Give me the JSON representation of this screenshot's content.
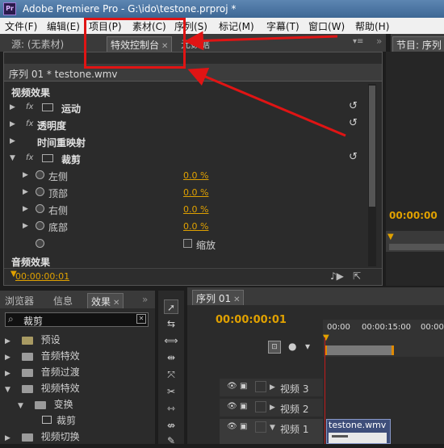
{
  "window": {
    "title": "Adobe Premiere Pro - G:\\ido\\testone.prproj *",
    "logo": "Pr"
  },
  "menu": [
    "文件(F)",
    "编辑(E)",
    "项目(P)",
    "素材(C)",
    "序列(S)",
    "标记(M)",
    "字幕(T)",
    "窗口(W)",
    "帮助(H)"
  ],
  "upper_left_tabs": {
    "source": "源: (无素材)",
    "effects_control": "特效控制台",
    "metadata": "元数据"
  },
  "program_tab": "节目: 序列",
  "effects_control": {
    "sequence_label": "序列 01 * testone.wmv",
    "video_effects_header": "视频效果",
    "effects": [
      {
        "name": "运动",
        "has_fx": true,
        "has_icon": true
      },
      {
        "name": "透明度",
        "has_fx": true,
        "has_icon": false
      },
      {
        "name": "时间重映射",
        "has_fx": false,
        "has_icon": false
      },
      {
        "name": "裁剪",
        "has_fx": true,
        "has_icon": true
      }
    ],
    "crop_params": [
      {
        "name": "左侧",
        "value": "0.0 %"
      },
      {
        "name": "顶部",
        "value": "0.0 %"
      },
      {
        "name": "右侧",
        "value": "0.0 %"
      },
      {
        "name": "底部",
        "value": "0.0 %"
      }
    ],
    "zoom_label": "缩放",
    "audio_effects_header": "音频效果",
    "timecode": "00:00:00:01",
    "fx_symbol": "fx"
  },
  "program": {
    "timecode": "00:00:00"
  },
  "lower_left_tabs": {
    "browser": "浏览器",
    "info": "信息",
    "effects": "效果"
  },
  "effects_panel": {
    "search_value": "裁剪",
    "tree": [
      {
        "label": "预设",
        "indent": 0
      },
      {
        "label": "音频特效",
        "indent": 0
      },
      {
        "label": "音频过渡",
        "indent": 0
      },
      {
        "label": "视频特效",
        "indent": 0
      },
      {
        "label": "变换",
        "indent": 1
      },
      {
        "label": "裁剪",
        "indent": 2
      },
      {
        "label": "视频切换",
        "indent": 0
      }
    ]
  },
  "timeline": {
    "tab": "序列 01",
    "timecode": "00:00:00:01",
    "ruler": [
      "00:00",
      "00:00:15:00",
      "00:00"
    ],
    "tracks": [
      "视频 3",
      "视频 2",
      "视频 1"
    ],
    "clip": "testone.wmv"
  },
  "colors": {
    "timecode": "#e0a100",
    "highlight_red": "#e01414",
    "accent": "#e0a100"
  }
}
